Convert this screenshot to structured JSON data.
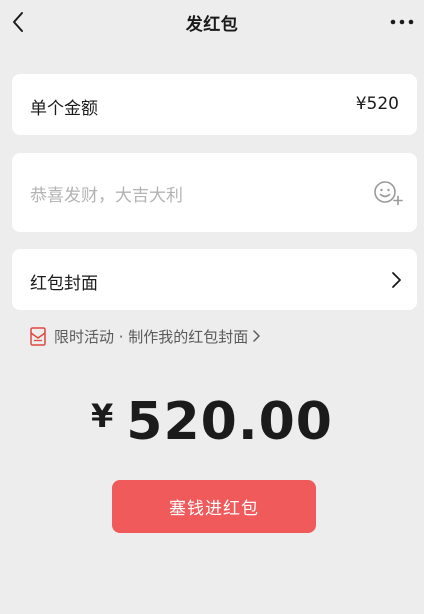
{
  "nav": {
    "title": "发红包"
  },
  "amount": {
    "label": "单个金额",
    "value": "¥520"
  },
  "greeting": {
    "placeholder": "恭喜发财，大吉大利"
  },
  "cover": {
    "label": "红包封面"
  },
  "promo": {
    "text": "限时活动 · 制作我的红包封面"
  },
  "total": {
    "currency": "¥",
    "amount": "520.00"
  },
  "submit": {
    "label": "塞钱进红包"
  },
  "colors": {
    "page_background": "#ededed",
    "card_background": "#ffffff",
    "primary_button": "#f05a5a",
    "placeholder_text": "#b3b3b3",
    "promo_icon": "#e0473f"
  },
  "icons": {
    "back": "back-arrow-icon",
    "more": "more-dots-icon",
    "emoji": "emoji-add-icon",
    "chevron": "chevron-right-icon",
    "promo": "red-envelope-icon"
  }
}
